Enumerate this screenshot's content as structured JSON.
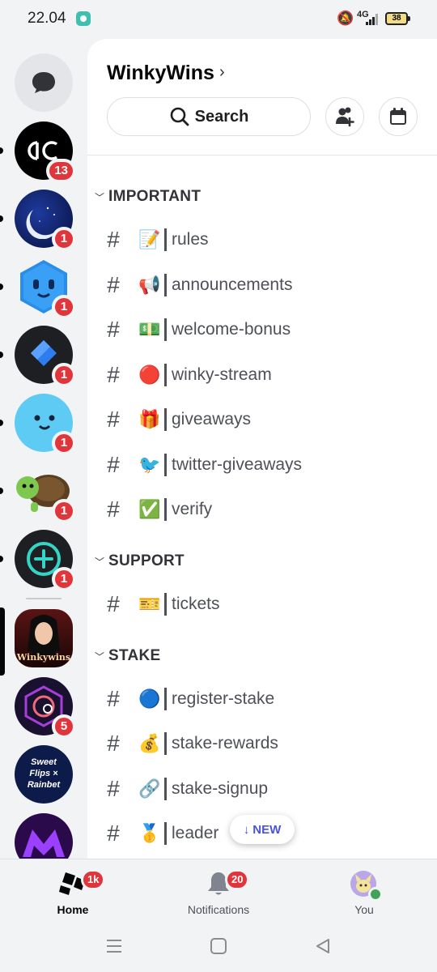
{
  "status_bar": {
    "time": "22.04",
    "network": "4G",
    "battery": "38"
  },
  "server_rail": {
    "dm_icon": "chat-bubble-icon",
    "servers": [
      {
        "name": "ac-server",
        "badge": "13",
        "bg": "#000000"
      },
      {
        "name": "moon-server",
        "badge": "1",
        "bg": "#0a1a5c"
      },
      {
        "name": "blue-hex-server",
        "badge": "1",
        "bg": "#f2f3f5"
      },
      {
        "name": "diamond-server",
        "badge": "1",
        "bg": "#1e1f22"
      },
      {
        "name": "smiley-server",
        "badge": "1",
        "bg": "#5ecbf5"
      },
      {
        "name": "turtle-server",
        "badge": "1",
        "bg": "#f2f3f5"
      },
      {
        "name": "add-circle-server",
        "badge": "1",
        "bg": "#1e1f22"
      },
      {
        "name": "winkywins-server",
        "badge": "",
        "bg": "#3a0d0d",
        "logo_text": "Winkywins"
      },
      {
        "name": "link-server",
        "badge": "5",
        "bg": "#1a1030"
      },
      {
        "name": "sweetflips-rainbet-server",
        "badge": "",
        "bg": "#0d1b4a",
        "logo_text": "Sweet Flips × Rainbet"
      },
      {
        "name": "purple-m-server",
        "badge": "",
        "bg": "#2a0a4a"
      }
    ]
  },
  "header": {
    "server_title": "WinkyWins",
    "title_chevron": "›",
    "search_label": "Search",
    "invite_icon": "add-member-icon",
    "events_icon": "calendar-icon"
  },
  "categories": [
    {
      "label": "IMPORTANT"
    },
    {
      "label": "SUPPORT"
    },
    {
      "label": "STAKE"
    }
  ],
  "channels": [
    {
      "emoji": "📝",
      "name": "rules"
    },
    {
      "emoji": "📢",
      "name": "announcements"
    },
    {
      "emoji": "💵",
      "name": "welcome-bonus"
    },
    {
      "emoji": "🔴",
      "name": "winky-stream"
    },
    {
      "emoji": "🎁",
      "name": "giveaways"
    },
    {
      "emoji": "🐦",
      "name": "twitter-giveaways"
    },
    {
      "emoji": "✅",
      "name": "verify"
    },
    {
      "emoji": "🎫",
      "name": "tickets"
    },
    {
      "emoji": "🔵",
      "name": "register-stake"
    },
    {
      "emoji": "💰",
      "name": "stake-rewards"
    },
    {
      "emoji": "🔗",
      "name": "stake-signup"
    },
    {
      "emoji": "🥇",
      "name": "leader"
    }
  ],
  "new_pill": {
    "arrow": "↓",
    "label": "NEW"
  },
  "bottom_nav": {
    "home": {
      "label": "Home",
      "badge": "1k"
    },
    "notifications": {
      "label": "Notifications",
      "badge": "20"
    },
    "you": {
      "label": "You"
    }
  },
  "colors": {
    "badge_red": "#e0353b",
    "accent_blue": "#4854e0",
    "online_green": "#43a25a"
  }
}
